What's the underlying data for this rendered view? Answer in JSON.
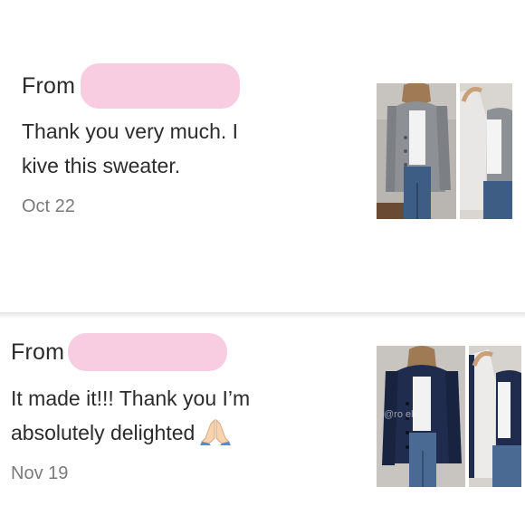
{
  "reviews": [
    {
      "from_label": "From",
      "message_lines": [
        "Thank you very much. I",
        "kive this sweater."
      ],
      "date": "Oct 22",
      "photos": [
        "grey-cardigan-front-photo",
        "grey-cardigan-lining-photo"
      ],
      "colors": {
        "redaction": "#f9c9de",
        "cardigan": "#8d9094",
        "lining": "#e9e7e6",
        "jeans": "#3d5d85"
      }
    },
    {
      "from_label": "From",
      "message_lines": [
        "It made it!!! Thank you I’m",
        "absolutely delighted"
      ],
      "emoji_icon": "folded-hands-icon",
      "date": "Nov 19",
      "photos": [
        "navy-cardigan-front-photo",
        "navy-cardigan-lining-photo"
      ],
      "watermark": "@ro  eli",
      "colors": {
        "redaction": "#f9c9de",
        "cardigan": "#1f2c4d",
        "lining": "#ecebea",
        "jeans": "#4a6a93"
      }
    }
  ]
}
